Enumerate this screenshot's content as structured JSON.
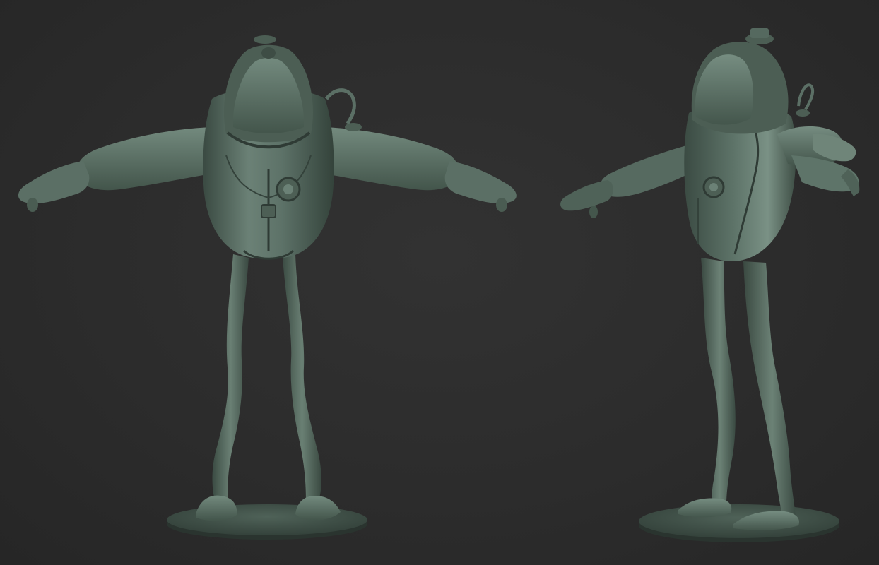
{
  "scene": {
    "background_color": "#2b2b2b",
    "material_base_color": "#55695f",
    "material_highlight_color": "#8fa497",
    "material_shadow_color": "#2f3b35",
    "views": [
      {
        "name": "front-view",
        "subject": "alien-diver-character"
      },
      {
        "name": "three-quarter-view",
        "subject": "alien-diver-character"
      }
    ]
  }
}
